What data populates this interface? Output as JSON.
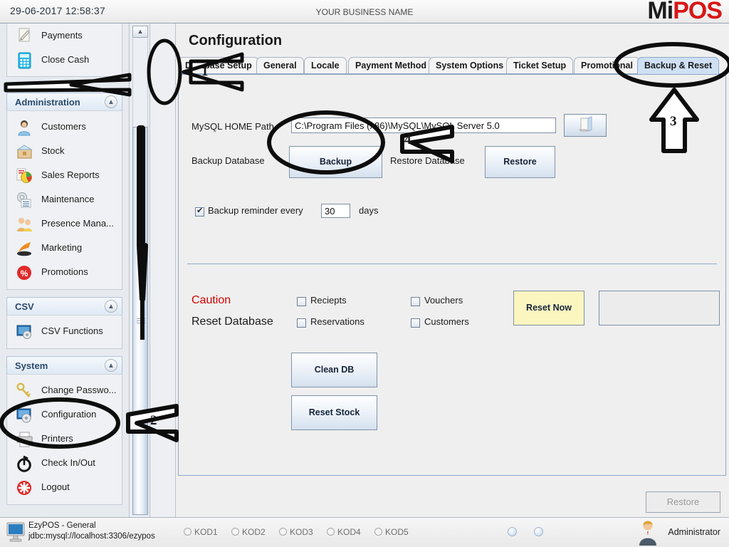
{
  "topbar": {
    "clock": "29-06-2017 12:58:37",
    "business_name": "YOUR BUSINESS NAME",
    "logo_mi": "Mi",
    "logo_pos": "POS"
  },
  "sidebar": {
    "top_partial_items": [
      {
        "label": "Payments",
        "icon": "pen-document-icon"
      },
      {
        "label": "Close Cash",
        "icon": "calculator-icon"
      }
    ],
    "groups": [
      {
        "title": "Administration",
        "collapse_icon": "chevron-up-double-icon",
        "items": [
          {
            "label": "Customers",
            "icon": "customer-person-icon"
          },
          {
            "label": "Stock",
            "icon": "stock-box-icon"
          },
          {
            "label": "Sales Reports",
            "icon": "sales-report-chart-icon"
          },
          {
            "label": "Maintenance",
            "icon": "maintenance-gear-icon"
          },
          {
            "label": "Presence Mana...",
            "icon": "presence-people-icon"
          },
          {
            "label": "Marketing",
            "icon": "marketing-arrow-icon"
          },
          {
            "label": "Promotions",
            "icon": "promotions-percent-icon"
          }
        ]
      },
      {
        "title": "CSV",
        "collapse_icon": "chevron-up-double-icon",
        "items": [
          {
            "label": "CSV Functions",
            "icon": "csv-monitor-gear-icon"
          }
        ]
      },
      {
        "title": "System",
        "collapse_icon": "chevron-up-double-icon",
        "items": [
          {
            "label": "Change Passwo...",
            "icon": "keys-icon"
          },
          {
            "label": "Configuration",
            "icon": "configuration-monitor-gear-icon"
          },
          {
            "label": "Printers",
            "icon": "printer-icon"
          },
          {
            "label": "Check In/Out",
            "icon": "stopwatch-icon"
          },
          {
            "label": "Logout",
            "icon": "logout-red-icon"
          }
        ]
      }
    ],
    "scrollbar": {
      "up_glyph": "▲",
      "down_glyph": "▼"
    },
    "collapse_button_glyph": "<"
  },
  "main": {
    "page_title": "Configuration",
    "tabs": [
      {
        "label": "Database Setup",
        "selected": false
      },
      {
        "label": "General",
        "selected": false
      },
      {
        "label": "Locale",
        "selected": false
      },
      {
        "label": "Payment Method",
        "selected": false
      },
      {
        "label": "System Options",
        "selected": false
      },
      {
        "label": "Ticket Setup",
        "selected": false
      },
      {
        "label": "Promotional",
        "selected": false
      },
      {
        "label": "Backup & Reset",
        "selected": true
      }
    ],
    "backup_section": {
      "mysql_home_label": "MySQL HOME Path",
      "mysql_home_value": "C:\\Program Files (x86)\\MySQL\\MySQL Server 5.0",
      "browse_icon": "folder-open-icon",
      "backup_database_label": "Backup Database",
      "backup_button": "Backup",
      "restore_database_label": "Restore Database",
      "restore_button": "Restore",
      "reminder_checked": true,
      "reminder_label": "Backup reminder every",
      "reminder_days_value": "30",
      "reminder_suffix": "days"
    },
    "reset_section": {
      "caution_label": "Caution",
      "caution_color": "#d40000",
      "reset_database_label": "Reset Database",
      "checkboxes": [
        {
          "label": "Reciepts",
          "checked": false
        },
        {
          "label": "Vouchers",
          "checked": false
        },
        {
          "label": "Reservations",
          "checked": false
        },
        {
          "label": "Customers",
          "checked": false
        }
      ],
      "reset_now_button": "Reset Now",
      "reset_now_color": "#fbf5c0",
      "output_field_value": "",
      "clean_db_button": "Clean DB",
      "reset_stock_button": "Reset Stock"
    },
    "bottom_restore_button": "Restore"
  },
  "status": {
    "app_name": "EzyPOS - General",
    "jdbc": "jdbc:mysql://localhost:3306/ezypos",
    "monitor_icon": "monitor-icon",
    "kods": [
      "KOD1",
      "KOD2",
      "KOD3",
      "KOD4",
      "KOD5"
    ],
    "user": "Administrator",
    "user_icon": "user-avatar-icon"
  },
  "annotations": {
    "markers": [
      "1",
      "2",
      "3",
      "4"
    ]
  }
}
